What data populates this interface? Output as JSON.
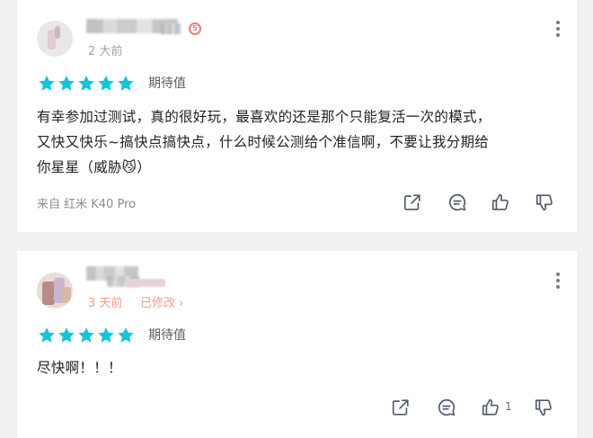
{
  "colors": {
    "star": "#14c4d8",
    "icon": "#505a66",
    "muted": "#a2a2a2",
    "edited": "#e9a08c",
    "level_badge": "#f07a7a"
  },
  "reviews": [
    {
      "time": "2 大前",
      "level_badge": "5",
      "stars": 5,
      "rating_label": "期待值",
      "text_lines": [
        "有幸参加过测试，真的很好玩，最喜欢的还是那个只能复活一次的模式，",
        "又快又快乐~搞快点搞快点，什么时候公测给个准信啊，不要让我分期给",
        "你星星（威胁😼）"
      ],
      "device": "来自 红米 K40 Pro",
      "icons": [
        "share-icon",
        "comment-icon",
        "thumbs-up-icon",
        "thumbs-down-icon"
      ]
    },
    {
      "time": "3 天前",
      "edited": "已修改 ›",
      "stars": 5,
      "rating_label": "期待值",
      "text_lines": [
        "尽快啊！！！"
      ],
      "like_count": "1",
      "icons": [
        "share-icon",
        "comment-icon",
        "thumbs-up-icon",
        "thumbs-down-icon"
      ]
    }
  ]
}
